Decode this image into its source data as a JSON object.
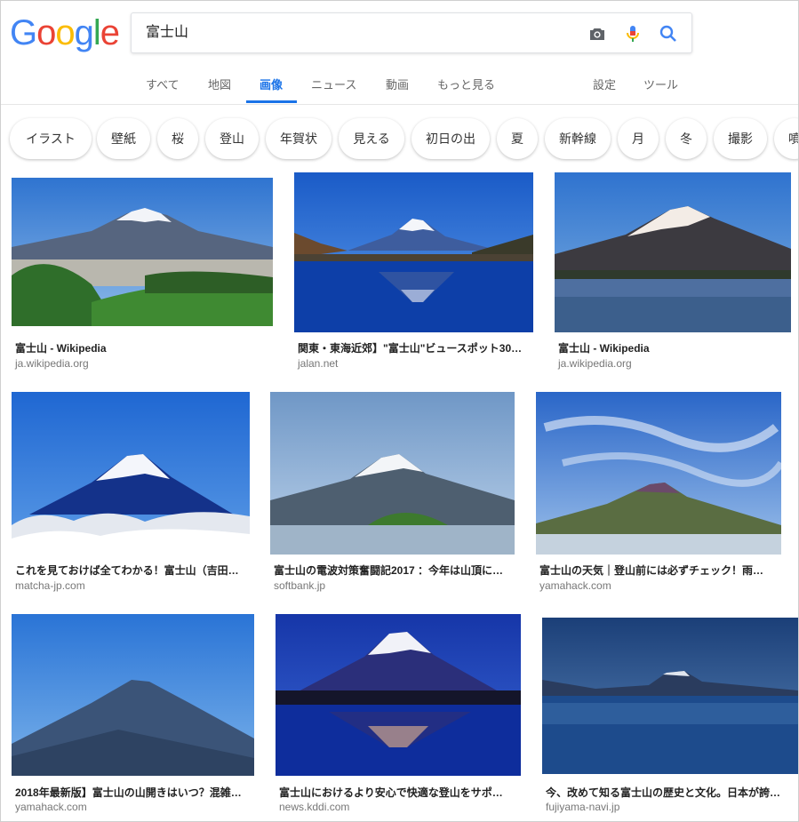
{
  "logo": {
    "letters": [
      "G",
      "o",
      "o",
      "g",
      "l",
      "e"
    ],
    "colors": [
      "#4285f4",
      "#ea4335",
      "#fbbc05",
      "#4285f4",
      "#34a853",
      "#ea4335"
    ]
  },
  "search": {
    "query": "富士山",
    "icons": [
      "camera-icon",
      "mic-icon",
      "search-icon"
    ]
  },
  "nav": {
    "tabs": [
      {
        "label": "すべて",
        "active": false
      },
      {
        "label": "地図",
        "active": false
      },
      {
        "label": "画像",
        "active": true
      },
      {
        "label": "ニュース",
        "active": false
      },
      {
        "label": "動画",
        "active": false
      },
      {
        "label": "もっと見る",
        "active": false
      }
    ],
    "settings": "設定",
    "tools": "ツール"
  },
  "chips": [
    "イラスト",
    "壁紙",
    "桜",
    "登山",
    "年賀状",
    "見える",
    "初日の出",
    "夏",
    "新幹線",
    "月",
    "冬",
    "撮影",
    "噴"
  ],
  "results": [
    {
      "title": "富士山 - Wikipedia",
      "site": "ja.wikipedia.org"
    },
    {
      "title": "関東・東海近郊】\"富士山\"ビュースポット30…",
      "site": "jalan.net"
    },
    {
      "title": "富士山 - Wikipedia",
      "site": "ja.wikipedia.org"
    },
    {
      "title": "これを見ておけば全てわかる！富士山（吉田…",
      "site": "matcha-jp.com"
    },
    {
      "title": "富士山の電波対策奮闘記2017 ：今年は山頂に…",
      "site": "softbank.jp"
    },
    {
      "title": "富士山の天気｜登山前には必ずチェック！雨…",
      "site": "yamahack.com"
    },
    {
      "title": "2018年最新版】富士山の山開きはいつ？混雑…",
      "site": "yamahack.com"
    },
    {
      "title": "富士山におけるより安心で快適な登山をサポ…",
      "site": "news.kddi.com"
    },
    {
      "title": "今、改めて知る富士山の歴史と文化。日本が誇…",
      "site": "fujiyama-navi.jp"
    }
  ],
  "colors": {
    "accent": "#1a73e8",
    "muted": "#777777"
  }
}
